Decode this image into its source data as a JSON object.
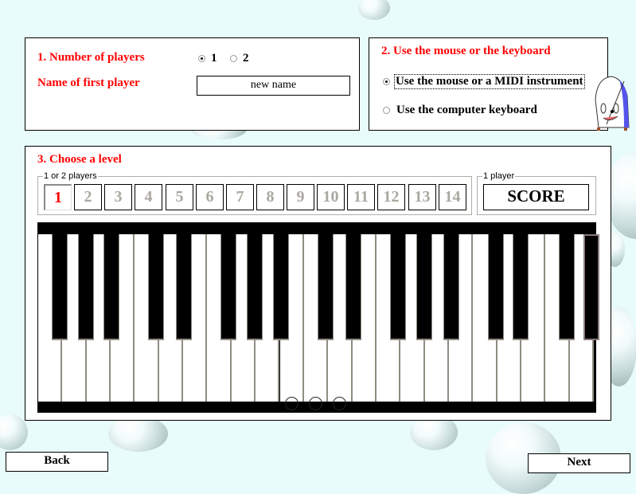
{
  "section_players": {
    "title": "1. Number of players",
    "options": [
      {
        "label": "1",
        "selected": true
      },
      {
        "label": "2",
        "selected": false
      }
    ],
    "name_label": "Name of first player",
    "name_value": "new name"
  },
  "section_input": {
    "title": "2. Use the mouse or the keyboard",
    "options": [
      {
        "label": "Use the mouse or a MIDI instrument",
        "selected": true
      },
      {
        "label": "Use the computer keyboard",
        "selected": false
      }
    ],
    "mascot_icon": "metronome-mascot-icon"
  },
  "section_level": {
    "title": "3. Choose a level",
    "group_label": "1 or 2 players",
    "levels": [
      "1",
      "2",
      "3",
      "4",
      "5",
      "6",
      "7",
      "8",
      "9",
      "10",
      "11",
      "12",
      "13",
      "14"
    ],
    "selected_level": "1",
    "score_group_label": "1 player",
    "score_label": "SCORE"
  },
  "keyboard": {
    "white_key_count": 23,
    "black_key_count": 17,
    "marked_white_keys": [
      10,
      11,
      12
    ]
  },
  "nav": {
    "back_label": "Back",
    "next_label": "Next"
  },
  "colors": {
    "title_red": "#ff0000",
    "level_disabled": "#aaa8a0",
    "background": "#e8fcfc"
  }
}
